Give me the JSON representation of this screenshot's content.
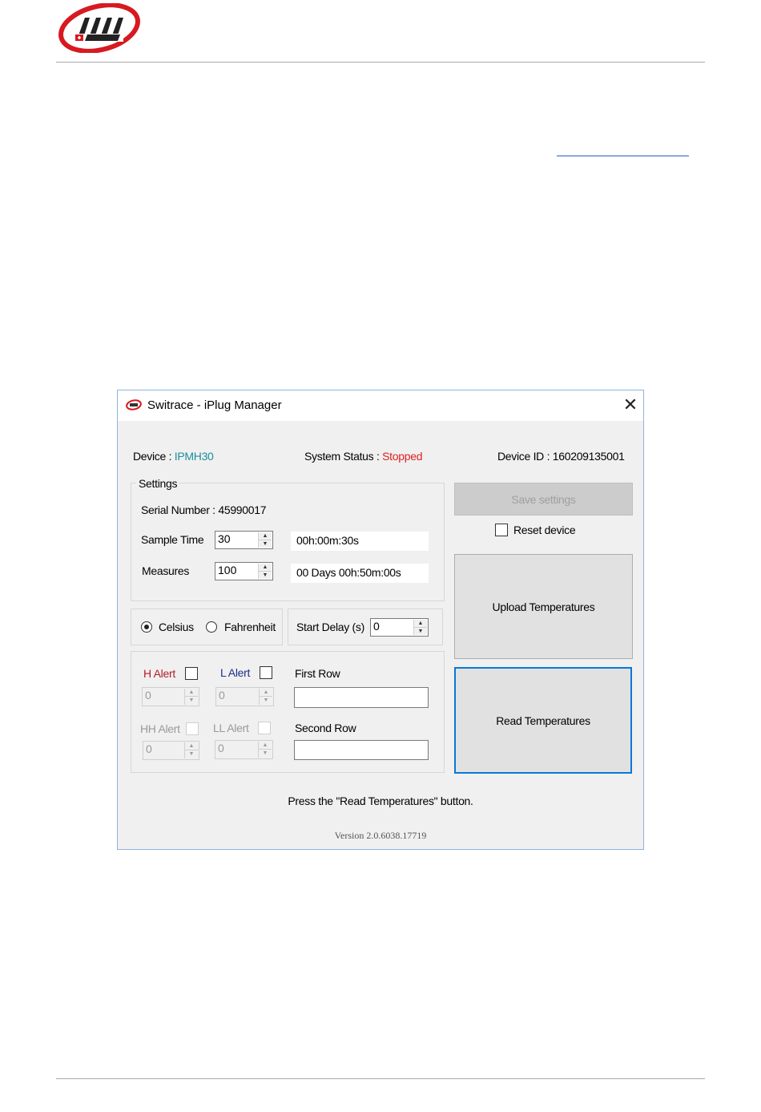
{
  "window": {
    "title": "Switrace - iPlug Manager",
    "close_glyph": "✕"
  },
  "status_row": {
    "device_label": "Device : ",
    "device_value": "IPMH30",
    "status_label": "System Status : ",
    "status_value": "Stopped",
    "device_id": "Device ID : 160209135001"
  },
  "settings": {
    "legend": "Settings",
    "serial": "Serial Number : 45990017",
    "sample_time_label": "Sample Time",
    "sample_time_value": "30",
    "sample_time_display": "00h:00m:30s",
    "measures_label": "Measures",
    "measures_value": "100",
    "measures_display": "00 Days 00h:50m:00s"
  },
  "units": {
    "celsius": "Celsius",
    "fahrenheit": "Fahrenheit",
    "selected": "Celsius"
  },
  "start_delay": {
    "label": "Start Delay (s)",
    "value": "0"
  },
  "alerts": {
    "h_alert": "H Alert",
    "h_value": "0",
    "l_alert": "L Alert",
    "l_value": "0",
    "hh_alert": "HH Alert",
    "hh_value": "0",
    "ll_alert": "LL Alert",
    "ll_value": "0",
    "first_row": "First Row",
    "first_row_value": "",
    "second_row": "Second Row",
    "second_row_value": ""
  },
  "buttons": {
    "save_settings": "Save settings",
    "reset_device": "Reset device",
    "upload": "Upload Temperatures",
    "read": "Read Temperatures"
  },
  "message": "Press the \"Read Temperatures\" button.",
  "version": "Version 2.0.6038.17719",
  "colors": {
    "device_value": "#1b8f9c",
    "status_stopped": "#e02020",
    "focus_border": "#0a78d7",
    "logo_red": "#d71920"
  },
  "icons": [
    "switrace-logo",
    "app-icon",
    "close-icon",
    "spinner-up-icon",
    "spinner-down-icon"
  ]
}
